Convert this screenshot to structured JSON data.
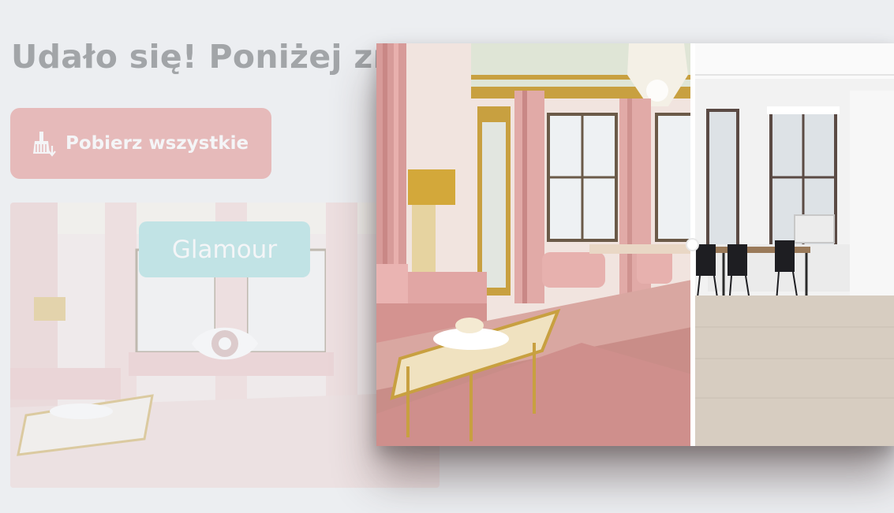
{
  "page": {
    "headline": "Udało się! Poniżej zna",
    "download_label": "Pobierz wszystkie"
  },
  "card": {
    "style_tag": "Glamour",
    "view_icon": "eye-icon"
  },
  "viewer": {
    "split_fraction": 0.61,
    "before_label": "",
    "after_label": ""
  },
  "colors": {
    "background": "#eceef1",
    "download_button": "#e07d78",
    "style_tag": "#8fd6d8",
    "pink_accent": "#d9a2a0",
    "gold_accent": "#c8a040"
  },
  "icons": {
    "download": "broom-download-icon",
    "view": "eye-icon"
  }
}
